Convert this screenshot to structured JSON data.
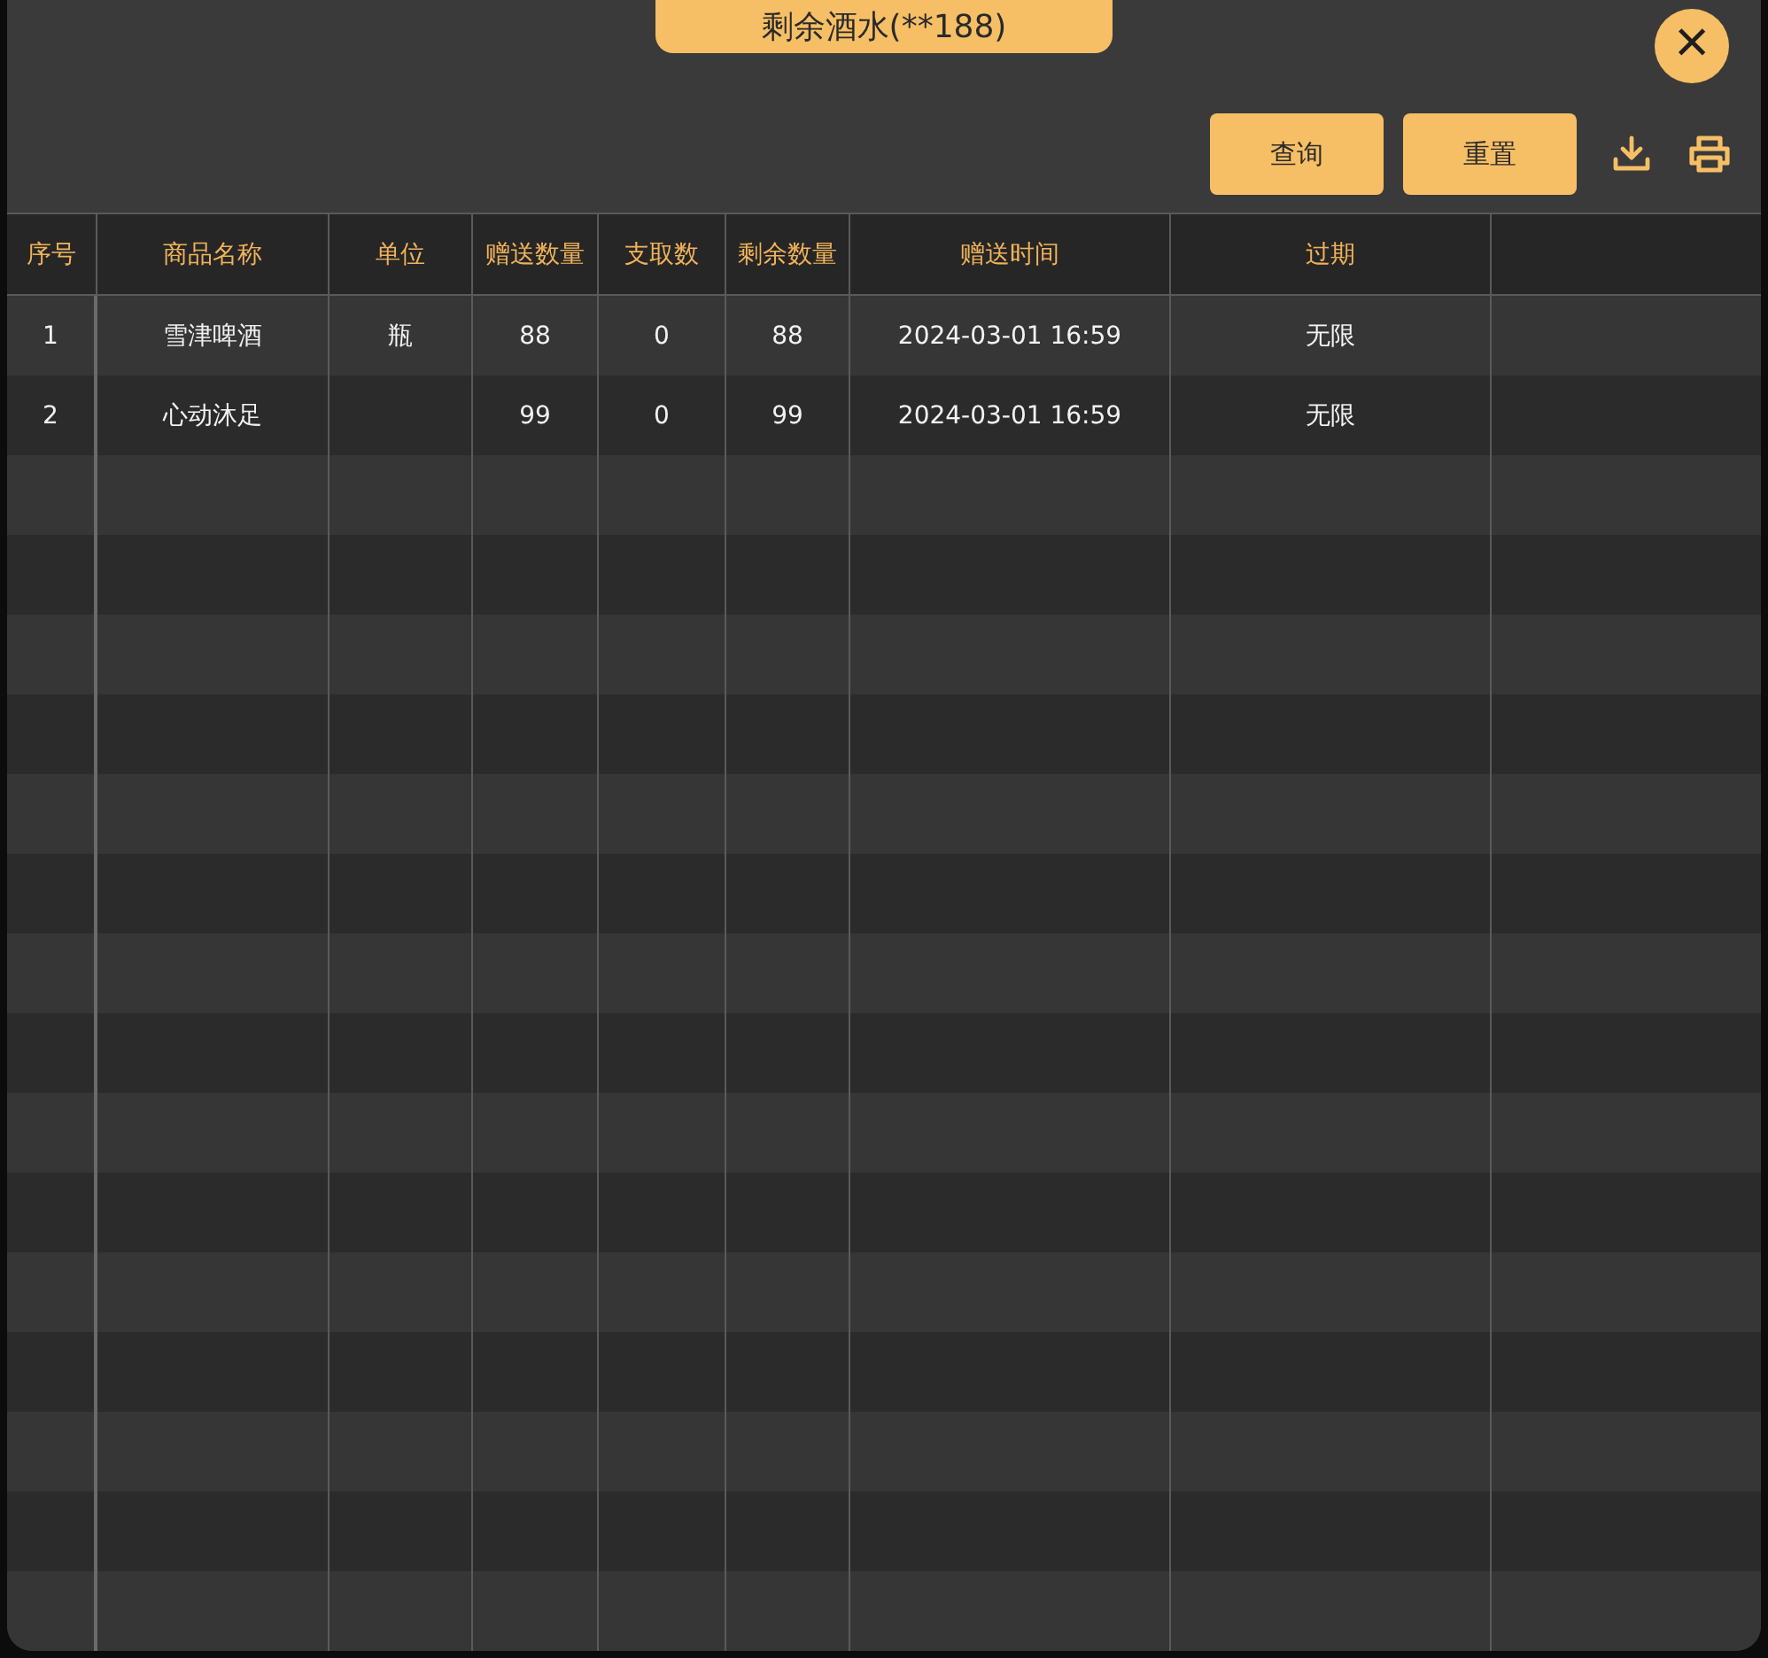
{
  "dialog": {
    "title": "剩余酒水(**188)",
    "close": "×"
  },
  "toolbar": {
    "buttons": [
      "查询",
      "重置"
    ]
  },
  "table": {
    "columns": [
      "序号",
      "商品名称",
      "单位",
      "赠送数量",
      "支取数",
      "剩余数量",
      "赠送时间",
      "过期"
    ],
    "rows": [
      [
        "1",
        "雪津啤酒",
        "瓶",
        "88",
        "0",
        "88",
        "2024-03-01 16:59",
        "无限"
      ],
      [
        "2",
        "心动沐足",
        "",
        "99",
        "0",
        "99",
        "2024-03-01 16:59",
        "无限"
      ]
    ]
  }
}
